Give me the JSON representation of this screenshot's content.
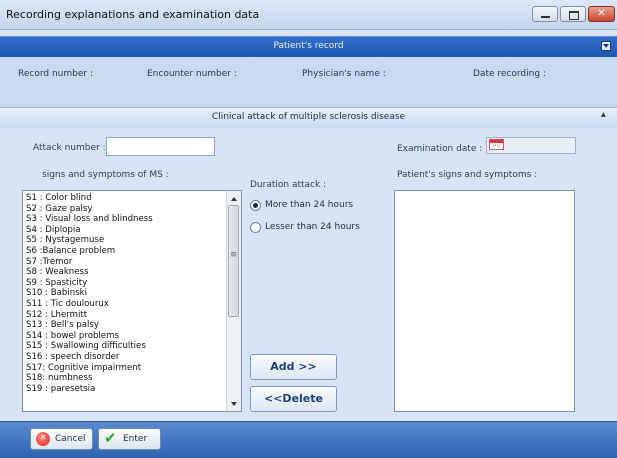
{
  "window": {
    "title": "Recording explanations and  examination data"
  },
  "record_section": {
    "title": "Patient's record",
    "fields": {
      "record_number": "Record number :",
      "encounter_number": "Encounter number :",
      "physician_name": "Physician's name :",
      "date_recording": "Date recording :"
    }
  },
  "clinical_section": {
    "title": "Clinical attack of multiple sclerosis disease",
    "attack_number_label": "Attack number :",
    "attack_number_value": "",
    "examination_date_label": "Examination date :",
    "signs_label": "signs and symptoms of MS :",
    "signs": [
      "S1 : Color blind",
      "S2 : Gaze palsy",
      "S3 : Visual loss and blindness",
      "S4 : Diplopia",
      "S5 : Nystagemuse",
      "S6 :Balance problem",
      "S7 :Tremor",
      "S8 : Weakness",
      "S9 : Spasticity",
      "S10 : Babinski",
      "S11 : Tic doulourux",
      "S12 : Lhermitt",
      "S13 : Bell's palsy",
      "S14 : bowel problems",
      "S15 : Swallowing difficulties",
      "S16 : speech disorder",
      "S17: Cognitive impairment",
      "S18: numbness",
      "S19 : paresetsia"
    ],
    "duration_label": "Duration attack :",
    "duration_options": [
      {
        "label": "More than 24 hours",
        "selected": true
      },
      {
        "label": "Lesser than 24 hours",
        "selected": false
      }
    ],
    "patient_signs_label": "Patient's signs and symptoms :",
    "add_label": "Add >>",
    "delete_label": "<<Delete"
  },
  "footer": {
    "cancel_label": "Cancel",
    "enter_label": "Enter"
  },
  "icons": {
    "collapse_record": "chevron-down-icon",
    "collapse_clinical": "double-chevron-up-icon",
    "calendar": "calendar-icon",
    "cancel": "cancel-icon",
    "enter": "checkmark-icon"
  }
}
